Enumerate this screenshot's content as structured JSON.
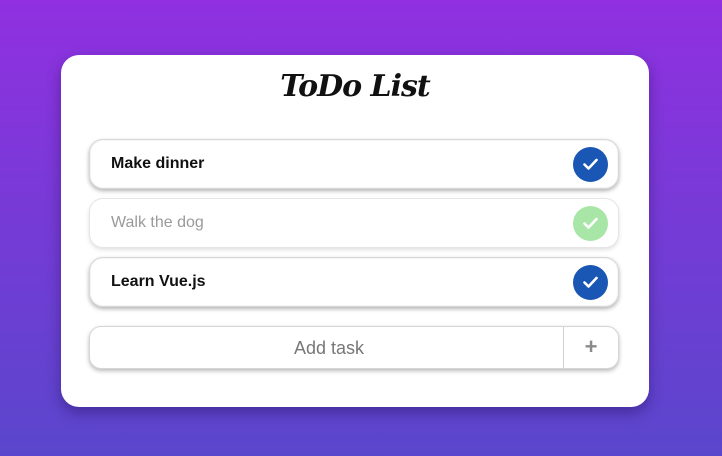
{
  "app": {
    "title": "ToDo List"
  },
  "tasks": [
    {
      "label": "Make dinner",
      "done": false
    },
    {
      "label": "Walk the dog",
      "done": true
    },
    {
      "label": "Learn Vue.js",
      "done": false
    }
  ],
  "add": {
    "placeholder": "Add task",
    "button_label": "+"
  },
  "colors": {
    "background_top": "#9030e0",
    "background_bottom": "#5a46cc",
    "check_active": "#1a56b4",
    "check_done": "#a8e6a8",
    "done_text": "#9a9a9a"
  },
  "icons": {
    "check": "check-icon"
  }
}
